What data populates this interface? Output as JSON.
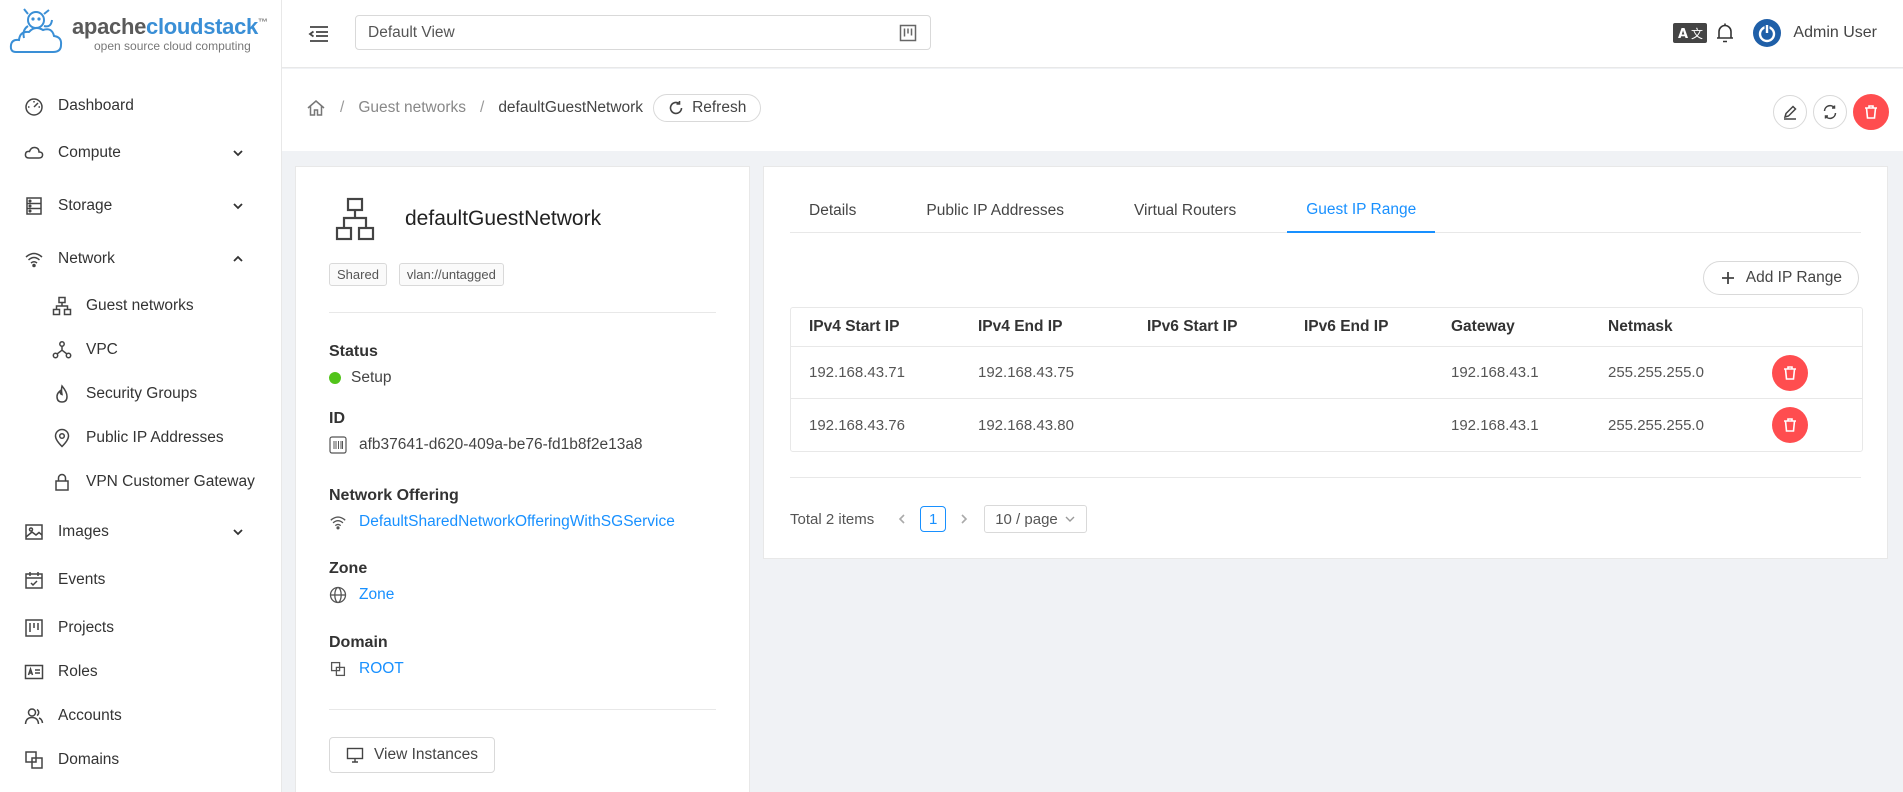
{
  "logo": {
    "apache": "apache",
    "cloudstack": "cloudstack",
    "tm": "™",
    "tagline": "open source cloud computing"
  },
  "sidebar": {
    "dashboard": "Dashboard",
    "compute": "Compute",
    "storage": "Storage",
    "network": "Network",
    "network_sub": [
      "Guest networks",
      "VPC",
      "Security Groups",
      "Public IP Addresses",
      "VPN Customer Gateway"
    ],
    "images": "Images",
    "events": "Events",
    "projects": "Projects",
    "roles": "Roles",
    "accounts": "Accounts",
    "domains": "Domains"
  },
  "header": {
    "view_select": "Default View",
    "user_name": "Admin User"
  },
  "breadcrumb": {
    "parent": "Guest networks",
    "current": "defaultGuestNetwork",
    "refresh_label": "Refresh",
    "sep": "/"
  },
  "info": {
    "name": "defaultGuestNetwork",
    "tags": [
      "Shared",
      "vlan://untagged"
    ],
    "status_label": "Status",
    "status_value": "Setup",
    "id_label": "ID",
    "id_value": "afb37641-d620-409a-be76-fd1b8f2e13a8",
    "offering_label": "Network Offering",
    "offering_value": "DefaultSharedNetworkOfferingWithSGService",
    "zone_label": "Zone",
    "zone_value": "Zone",
    "domain_label": "Domain",
    "domain_value": "ROOT",
    "view_instances": "View Instances"
  },
  "tabs": [
    "Details",
    "Public IP Addresses",
    "Virtual Routers",
    "Guest IP Range"
  ],
  "active_tab": "Guest IP Range",
  "add_ip_range": "Add IP Range",
  "table": {
    "columns": [
      "IPv4 Start IP",
      "IPv4 End IP",
      "IPv6 Start IP",
      "IPv6 End IP",
      "Gateway",
      "Netmask"
    ],
    "rows": [
      [
        "192.168.43.71",
        "192.168.43.75",
        "",
        "",
        "192.168.43.1",
        "255.255.255.0"
      ],
      [
        "192.168.43.76",
        "192.168.43.80",
        "",
        "",
        "192.168.43.1",
        "255.255.255.0"
      ]
    ]
  },
  "pagination": {
    "total": "Total 2 items",
    "current_page": "1",
    "page_size": "10 / page"
  },
  "colors": {
    "accent": "#1890ff",
    "danger": "#ff4d4f",
    "success": "#52c41a"
  }
}
